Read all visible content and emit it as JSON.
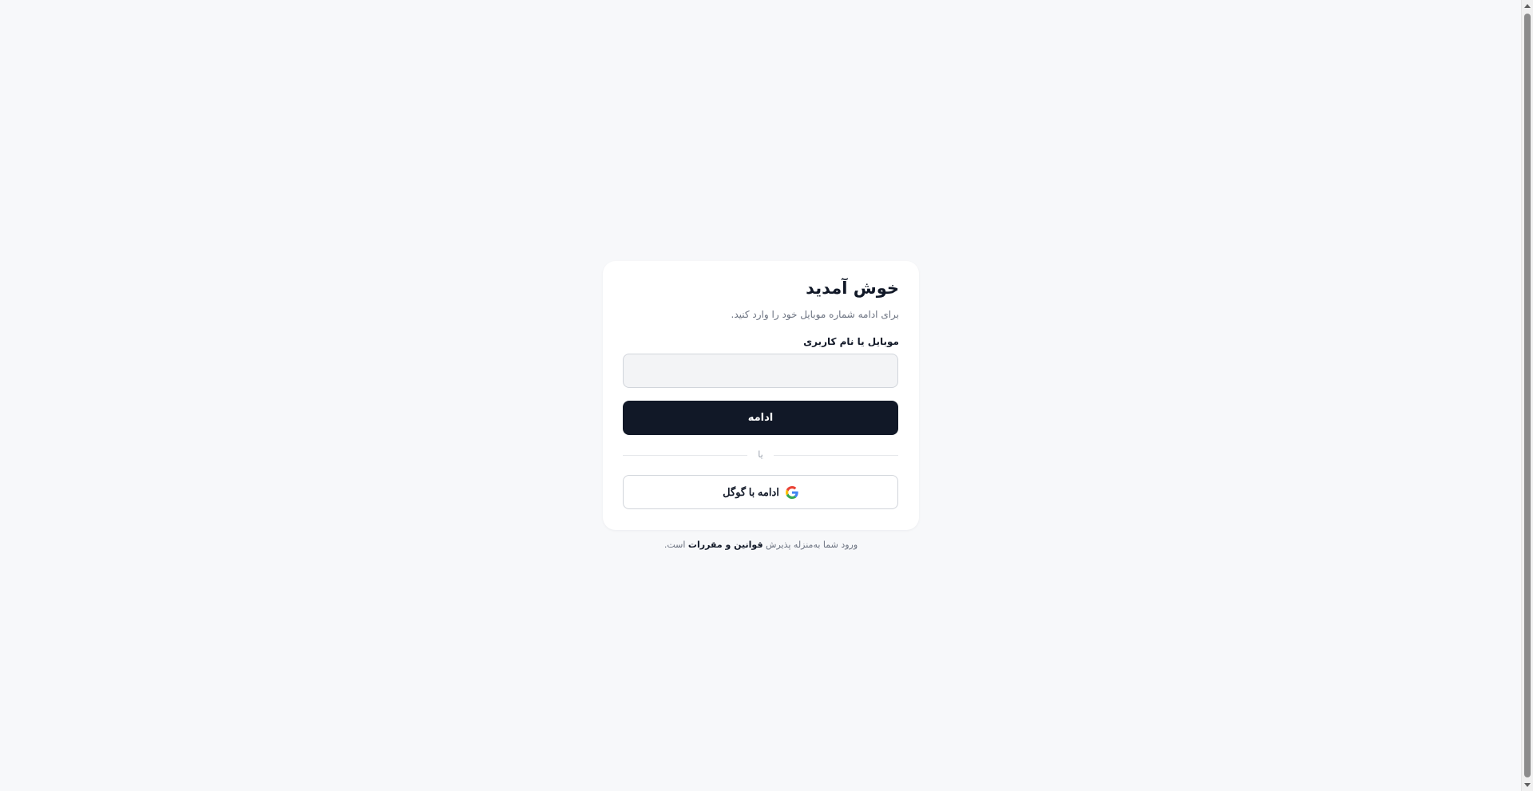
{
  "login": {
    "title": "خوش آمدید",
    "subtitle": "برای ادامه شماره موبایل خود را وارد کنید.",
    "field_label": "موبایل یا نام کاربری",
    "field_value": "",
    "continue_label": "ادامه",
    "divider_text": "یا",
    "google_label": "ادامه با گوگل",
    "google_icon": "google-icon"
  },
  "footer": {
    "prefix": "ورود شما به‌منزله پذیرش",
    "link_label": "قوانین و مقررات",
    "suffix": "است."
  },
  "colors": {
    "background": "#f7f8fa",
    "card": "#ffffff",
    "primary": "#111827",
    "muted_text": "#6b7280",
    "input_bg": "#f3f4f6",
    "border": "#d1d5db"
  }
}
